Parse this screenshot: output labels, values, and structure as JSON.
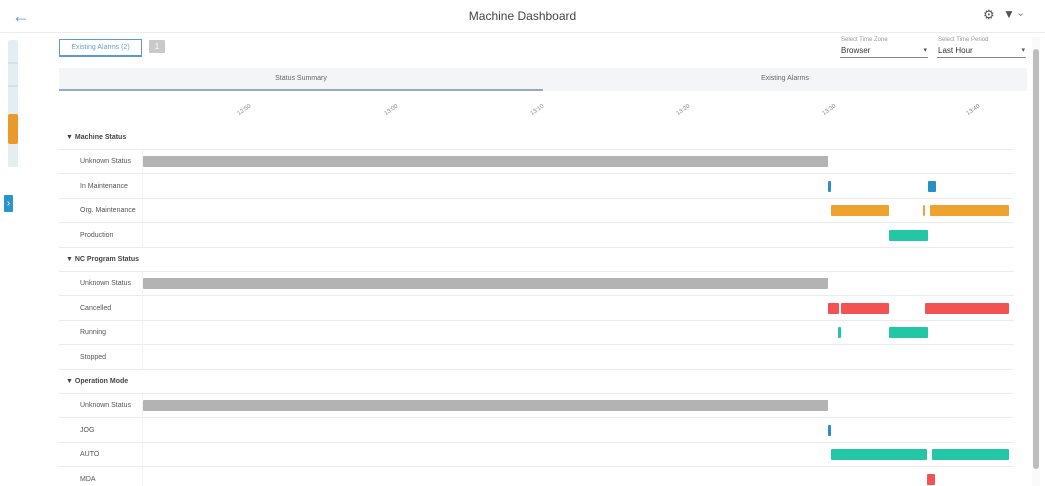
{
  "header": {
    "title": "Machine Dashboard",
    "back_icon": "arrow-left-icon",
    "settings_icon": "gear-icon",
    "filter_icon": "filter-icon",
    "menu_icon": "chevron-down-icon"
  },
  "pinned_tab": {
    "label": "Existing Alarms (2)",
    "count": "1"
  },
  "time_zone": {
    "label": "Select Time Zone",
    "value": "Browser"
  },
  "time_period": {
    "label": "Select Time Period",
    "value": "Last Hour"
  },
  "tabs": [
    {
      "label": "Status Summary",
      "active": true
    },
    {
      "label": "Existing Alarms",
      "active": false
    }
  ],
  "colors": {
    "gray": "#b3b3b3",
    "blue": "#2a8fc4",
    "orange": "#f0a22e",
    "teal": "#23c6a5",
    "red": "#f25252"
  },
  "timeline": {
    "ticks": [
      "12:50",
      "13:00",
      "13:10",
      "13:20",
      "13:30",
      "13:40"
    ],
    "groups": [
      {
        "label": "Machine Status",
        "rows": [
          {
            "label": "Unknown Status",
            "bars": [
              {
                "start": 0.0,
                "end": 0.787,
                "color": "gray"
              }
            ]
          },
          {
            "label": "In Maintenance",
            "bars": [
              {
                "start": 0.787,
                "end": 0.79,
                "color": "blue"
              },
              {
                "start": 0.901,
                "end": 0.91,
                "color": "blue"
              }
            ]
          },
          {
            "label": "Org. Maintenance",
            "bars": [
              {
                "start": 0.79,
                "end": 0.856,
                "color": "orange"
              },
              {
                "start": 0.895,
                "end": 0.898,
                "color": "orange"
              },
              {
                "start": 0.903,
                "end": 0.994,
                "color": "orange"
              }
            ]
          },
          {
            "label": "Production",
            "bars": [
              {
                "start": 0.856,
                "end": 0.901,
                "color": "teal"
              }
            ]
          }
        ]
      },
      {
        "label": "NC Program Status",
        "rows": [
          {
            "label": "Unknown Status",
            "bars": [
              {
                "start": 0.0,
                "end": 0.787,
                "color": "gray"
              }
            ]
          },
          {
            "label": "Cancelled",
            "bars": [
              {
                "start": 0.787,
                "end": 0.799,
                "color": "red"
              },
              {
                "start": 0.801,
                "end": 0.856,
                "color": "red"
              },
              {
                "start": 0.898,
                "end": 0.994,
                "color": "red"
              }
            ]
          },
          {
            "label": "Running",
            "bars": [
              {
                "start": 0.798,
                "end": 0.801,
                "color": "teal"
              },
              {
                "start": 0.856,
                "end": 0.901,
                "color": "teal"
              }
            ]
          },
          {
            "label": "Stopped",
            "bars": []
          }
        ]
      },
      {
        "label": "Operation Mode",
        "rows": [
          {
            "label": "Unknown Status",
            "bars": [
              {
                "start": 0.0,
                "end": 0.787,
                "color": "gray"
              }
            ]
          },
          {
            "label": "JOG",
            "bars": [
              {
                "start": 0.787,
                "end": 0.79,
                "color": "blue"
              }
            ]
          },
          {
            "label": "AUTO",
            "bars": [
              {
                "start": 0.79,
                "end": 0.9,
                "color": "teal"
              },
              {
                "start": 0.906,
                "end": 0.994,
                "color": "teal"
              }
            ]
          },
          {
            "label": "MDA",
            "bars": [
              {
                "start": 0.9,
                "end": 0.909,
                "color": "red"
              }
            ]
          }
        ]
      }
    ]
  }
}
